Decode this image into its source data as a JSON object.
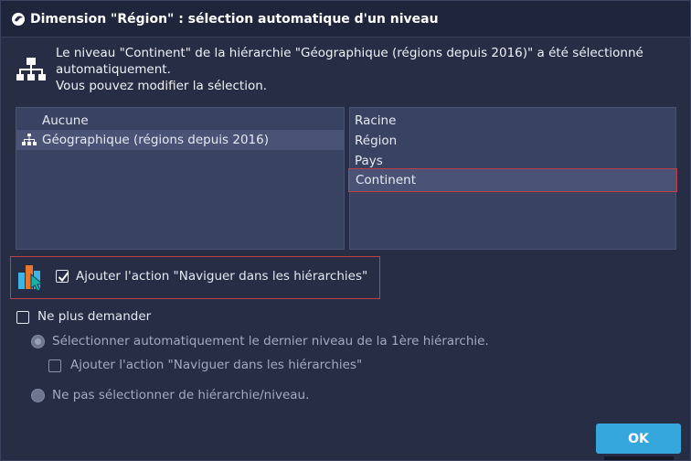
{
  "window": {
    "title": "Dimension \"Région\" : sélection automatique d'un niveau",
    "app_icon": "app-logo-icon"
  },
  "info": {
    "icon": "hierarchy-icon",
    "line1": "Le niveau \"Continent\" de la hiérarchie \"Géographique (régions depuis 2016)\" a été sélectionné",
    "line2": "automatiquement.",
    "line3": "Vous pouvez modifier la sélection."
  },
  "hierarchies": {
    "items": [
      {
        "label": "Aucune",
        "selected": false,
        "icon": ""
      },
      {
        "label": "Géographique (régions depuis 2016)",
        "selected": true,
        "icon": "hierarchy-icon"
      }
    ]
  },
  "levels": {
    "items": [
      {
        "label": "Racine",
        "selected": false
      },
      {
        "label": "Région",
        "selected": false
      },
      {
        "label": "Pays",
        "selected": false
      },
      {
        "label": "Continent",
        "selected": true
      }
    ]
  },
  "navigate_action": {
    "icon": "navigate-hierarchies-icon",
    "label": "Ajouter l'action \"Naviguer dans les hiérarchies\"",
    "checked": true
  },
  "dont_ask": {
    "label": "Ne plus demander",
    "checked": false
  },
  "options": {
    "auto_last_level": {
      "label": "Sélectionner automatiquement le dernier niveau de la 1ère hiérarchie.",
      "selected": true,
      "enabled": false
    },
    "add_navigate_action": {
      "label": "Ajouter l'action \"Naviguer dans les hiérarchies\"",
      "checked": false,
      "enabled": false
    },
    "no_selection": {
      "label": "Ne pas sélectionner de hiérarchie/niveau.",
      "selected": false,
      "enabled": false
    }
  },
  "buttons": {
    "ok_label": "OK"
  },
  "colors": {
    "accent": "#36a7dd",
    "highlight_border": "#c0404a",
    "background": "#262d45"
  }
}
